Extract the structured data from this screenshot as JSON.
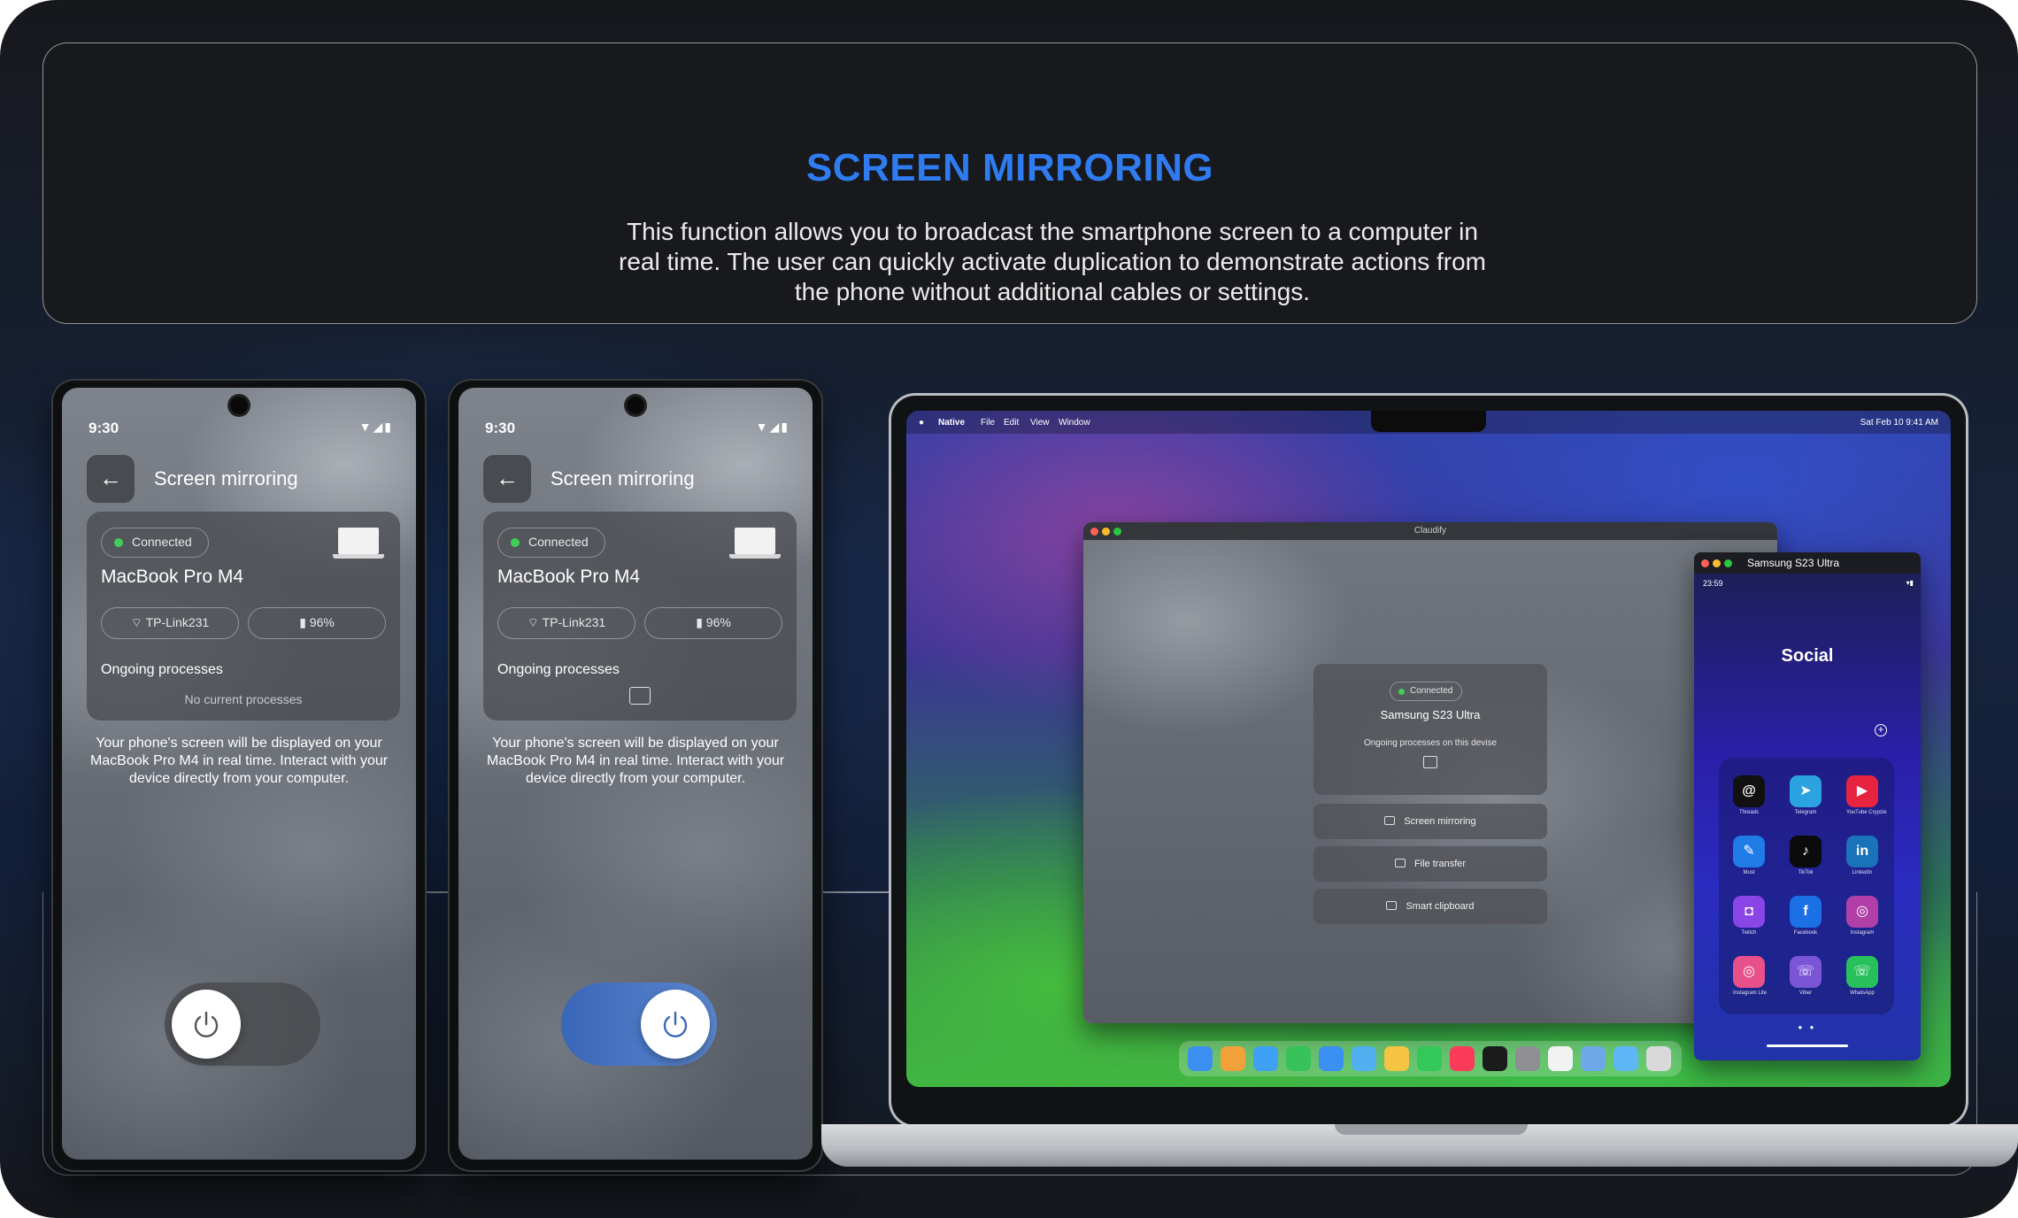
{
  "header": {
    "title": "SCREEN MIRRORING",
    "description": "This function allows you to broadcast the smartphone screen to a computer in real time. The user can quickly activate duplication to demonstrate actions from the phone without additional cables or settings."
  },
  "phone_left": {
    "status_time": "9:30",
    "status_icons": "▼◢▮",
    "back_glyph": "←",
    "title": "Screen mirroring",
    "connection": "Connected",
    "device_name": "MacBook Pro M4",
    "wifi": "TP-Link231",
    "battery": "96%",
    "ongoing_label": "Ongoing processes",
    "no_processes": "No current processes",
    "hint": "Your phone's screen will be displayed on your MacBook Pro M4 in real time. Interact with your device directly from your computer.",
    "toggle_on": false
  },
  "phone_right": {
    "status_time": "9:30",
    "status_icons": "▼◢▮",
    "back_glyph": "←",
    "title": "Screen mirroring",
    "connection": "Connected",
    "device_name": "MacBook Pro M4",
    "wifi": "TP-Link231",
    "battery": "96%",
    "ongoing_label": "Ongoing processes",
    "hint": "Your phone's screen will be displayed on your MacBook Pro M4 in real time. Interact with your device directly from your computer.",
    "toggle_on": true
  },
  "mac": {
    "menubar": {
      "apple_glyph": "●",
      "items": [
        "Native",
        "File",
        "Edit",
        "View",
        "Window"
      ],
      "datetime": "Sat Feb 10  9:41 AM"
    },
    "app_window": {
      "title": "Claudify",
      "connection": "Connected",
      "device_name": "Samsung S23 Ultra",
      "ongoing_label": "Ongoing processes on this devise",
      "buttons": [
        "Screen mirroring",
        "File transfer",
        "Smart clipboard"
      ]
    },
    "phone_window": {
      "title": "Samsung S23 Ultra",
      "time": "23:59",
      "status": "▾▮",
      "folder_title": "Social",
      "plus_glyph": "+",
      "page_dots": "● ●",
      "apps": [
        {
          "name": "Threads",
          "glyph": "@",
          "color": "#111111"
        },
        {
          "name": "Telegram",
          "glyph": "➤",
          "color": "#2aa3e0"
        },
        {
          "name": "YouTube Crypzie",
          "glyph": "▶",
          "color": "#e8233f"
        },
        {
          "name": "Must",
          "glyph": "✎",
          "color": "#1f7be6"
        },
        {
          "name": "TikTok",
          "glyph": "♪",
          "color": "#0b0b0b"
        },
        {
          "name": "LinkedIn",
          "glyph": "in",
          "color": "#1a72b8"
        },
        {
          "name": "Twitch",
          "glyph": "◘",
          "color": "#8a45e6"
        },
        {
          "name": "Facebook",
          "glyph": "f",
          "color": "#1b70e6"
        },
        {
          "name": "Instagram",
          "glyph": "◎",
          "color": "#b040a8"
        },
        {
          "name": "Instagram Lite",
          "glyph": "◎",
          "color": "#e8508a"
        },
        {
          "name": "Viber",
          "glyph": "☏",
          "color": "#7a55d6"
        },
        {
          "name": "WhatsApp",
          "glyph": "☏",
          "color": "#27c05a"
        }
      ]
    },
    "dock_colors": [
      "#3a8ff0",
      "#f2a03a",
      "#3fa1f5",
      "#37c25a",
      "#3a8ff0",
      "#50b0f0",
      "#f6c443",
      "#34c759",
      "#fa3c5a",
      "#1b1b1b",
      "#8e8e93",
      "#f2f2f2",
      "#6fa8e8",
      "#5fb6f5",
      "#d9d9d9"
    ]
  }
}
